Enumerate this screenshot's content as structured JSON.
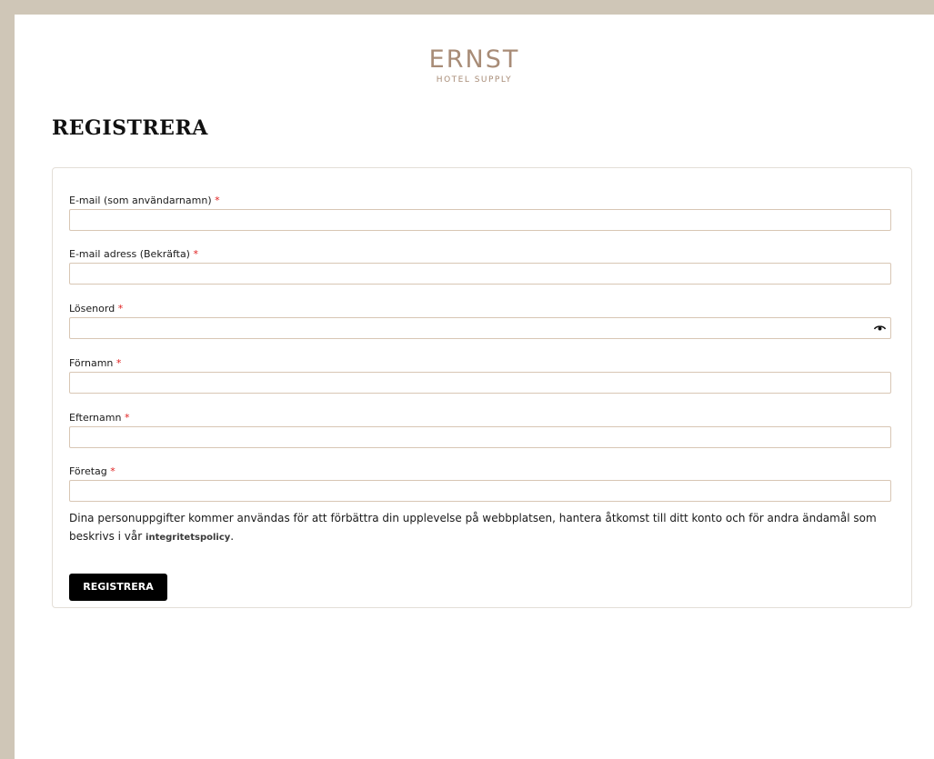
{
  "logo": {
    "main": "ERNST",
    "sub": "HOTEL SUPPLY"
  },
  "page": {
    "title": "REGISTRERA"
  },
  "form": {
    "fields": [
      {
        "label": "E-mail (som användarnamn)",
        "required": "*",
        "value": ""
      },
      {
        "label": "E-mail adress (Bekräfta)",
        "required": "*",
        "value": ""
      },
      {
        "label": "Lösenord",
        "required": "*",
        "value": "",
        "icon": "eye-icon"
      },
      {
        "label": "Förnamn",
        "required": "*",
        "value": ""
      },
      {
        "label": "Efternamn",
        "required": "*",
        "value": ""
      },
      {
        "label": "Företag",
        "required": "*",
        "value": ""
      }
    ],
    "notice": "Dina personuppgifter kommer användas för att förbättra din upplevelse på webbplatsen, hantera åtkomst till ditt konto och för andra ändamål som beskrivs i vår",
    "policy_link": "integritetspolicy",
    "notice_end": ".",
    "submit_label": "REGISTRERA"
  },
  "colors": {
    "outer_background": "#cfc6b7",
    "brand": "#a88c77",
    "required_marker": "#e02020",
    "input_border": "#d8c6b4",
    "button_background": "#000000"
  }
}
